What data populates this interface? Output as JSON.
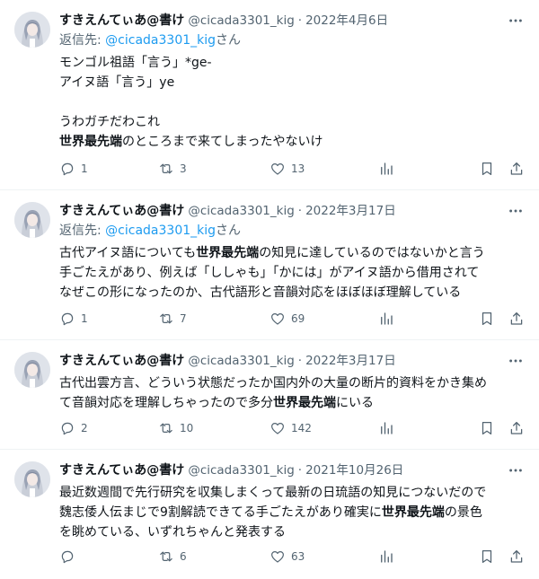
{
  "tweets": [
    {
      "name": "すきえんてぃあ@書け",
      "handle": "@cicada3301_kig",
      "dot": "·",
      "date": "2022年4月6日",
      "reply_prefix": "返信先: ",
      "reply_mention": "@cicada3301_kig",
      "reply_suffix": "さん",
      "lines": [
        [
          "モンゴル祖語「言う」*ge-"
        ],
        [
          "アイヌ語「言う」ye"
        ],
        [
          ""
        ],
        [
          "うわガチだわこれ"
        ],
        [
          "世界最先端",
          "のところまで来てしまったやないけ"
        ]
      ],
      "replies": "1",
      "retweets": "3",
      "likes": "13"
    },
    {
      "name": "すきえんてぃあ@書け",
      "handle": "@cicada3301_kig",
      "dot": "·",
      "date": "2022年3月17日",
      "reply_prefix": "返信先: ",
      "reply_mention": "@cicada3301_kig",
      "reply_suffix": "さん",
      "lines": [
        [
          "古代アイヌ語についても",
          "世界最先端",
          "の知見に達しているのではないかと言う"
        ],
        [
          "手ごたえがあり、例えば「ししゃも」「かには」がアイヌ語から借用されて"
        ],
        [
          "なぜこの形になったのか、古代語形と音韻対応をほぼほぼ理解している"
        ]
      ],
      "replies": "1",
      "retweets": "7",
      "likes": "69"
    },
    {
      "name": "すきえんてぃあ@書け",
      "handle": "@cicada3301_kig",
      "dot": "·",
      "date": "2022年3月17日",
      "lines": [
        [
          "古代出雲方言、どういう状態だったか国内外の大量の断片的資料をかき集め"
        ],
        [
          "て音韻対応を理解しちゃったので多分",
          "世界最先端",
          "にいる"
        ]
      ],
      "replies": "2",
      "retweets": "10",
      "likes": "142"
    },
    {
      "name": "すきえんてぃあ@書け",
      "handle": "@cicada3301_kig",
      "dot": "·",
      "date": "2021年10月26日",
      "lines": [
        [
          "最近数週間で先行研究を収集しまくって最新の日琉語の知見につないだので"
        ],
        [
          "魏志倭人伝まじで9割解読できてる手ごたえがあり確実に",
          "世界最先端",
          "の景色"
        ],
        [
          "を眺めている、いずれちゃんと発表する"
        ]
      ],
      "replies": "",
      "retweets": "6",
      "likes": "63"
    }
  ],
  "icons": {
    "more": "more-dots-icon",
    "reply": "reply-bubble-icon",
    "retweet": "retweet-icon",
    "like": "heart-icon",
    "views": "views-chart-icon",
    "bookmark": "bookmark-icon",
    "share": "share-icon"
  },
  "colors": {
    "text": "#0f1419",
    "secondary": "#536471",
    "link": "#1d9bf0",
    "divider": "#eff3f4"
  }
}
